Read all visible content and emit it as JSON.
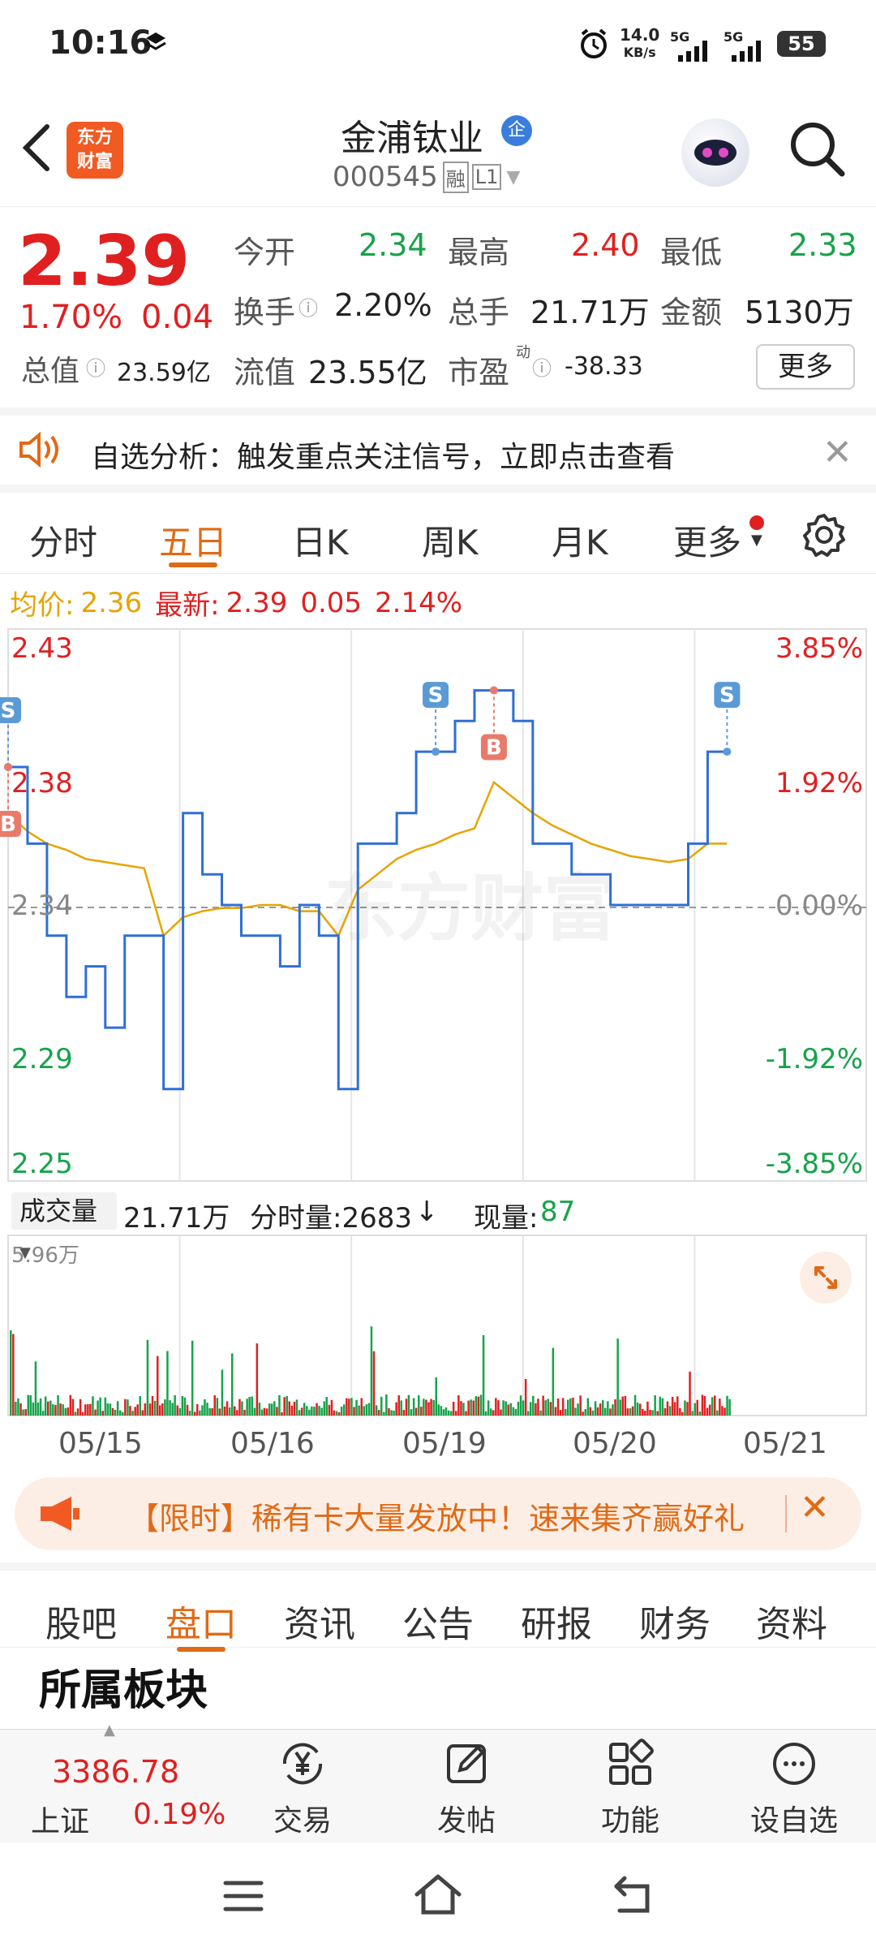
{
  "status": {
    "time": "10:16",
    "net_speed_value": "14.0",
    "net_speed_unit": "KB/s",
    "signal1": "5G",
    "signal2": "5G",
    "battery": "55"
  },
  "header": {
    "logo_line1": "东方",
    "logo_line2": "财富",
    "stock_name": "金浦钛业",
    "badge": "企",
    "stock_code": "000545",
    "tag1": "融",
    "tag2": "L1"
  },
  "quote": {
    "price": "2.39",
    "change_pct": "1.70%",
    "change": "0.04",
    "open_label": "今开",
    "open_value": "2.34",
    "high_label": "最高",
    "high_value": "2.40",
    "low_label": "最低",
    "low_value": "2.33",
    "turnover_label": "换手",
    "turnover_value": "2.20%",
    "volume_label": "总手",
    "volume_value": "21.71万",
    "amount_label": "金额",
    "amount_value": "5130万",
    "mktcap_label": "总值",
    "mktcap_value": "23.59亿",
    "float_label": "流值",
    "float_value": "23.55亿",
    "pe_label": "市盈",
    "pe_sup": "动",
    "pe_value": "-38.33",
    "more_label": "更多"
  },
  "banner": {
    "text": "自选分析：触发重点关注信号，立即点击查看"
  },
  "tabs": [
    "分时",
    "五日",
    "日K",
    "周K",
    "月K",
    "更多"
  ],
  "active_tab": "五日",
  "chart_header": {
    "avg_label": "均价:",
    "avg_value": "2.36",
    "latest_label": "最新:",
    "latest_value": "2.39",
    "latest_change": "0.05",
    "latest_pct": "2.14%"
  },
  "volume_header": {
    "label": "成交量",
    "total": "21.71万",
    "tick_label": "分时量:2683",
    "tick_arrow": "↓",
    "current_label": "现量:",
    "current_value": "87",
    "max_label": "5.96万"
  },
  "chart_data": {
    "type": "line",
    "x": [
      "05/15",
      "05/16",
      "05/19",
      "05/20",
      "05/21"
    ],
    "ylim": [
      2.25,
      2.43
    ],
    "y_ticks_left": [
      "2.43",
      "2.38",
      "2.34",
      "2.29",
      "2.25"
    ],
    "y_ticks_right": [
      "3.85%",
      "1.92%",
      "0.00%",
      "-1.92%",
      "-3.85%"
    ],
    "prev_close": 2.34,
    "series": [
      {
        "color": "#2f6fd6",
        "values": [
          2.385,
          2.36,
          2.33,
          2.31,
          2.32,
          2.3,
          2.33,
          2.33,
          2.28,
          2.37,
          2.35,
          2.34,
          2.33,
          2.33,
          2.32,
          2.34,
          2.33,
          2.28,
          2.36,
          2.36,
          2.37,
          2.39,
          2.39,
          2.4,
          2.41,
          2.41,
          2.4,
          2.36,
          2.36,
          2.35,
          2.35,
          2.34,
          2.34,
          2.34,
          2.34,
          2.36,
          2.39,
          2.39
        ]
      },
      {
        "color": "#e6a400",
        "values": [
          2.37,
          2.364,
          2.36,
          2.358,
          2.355,
          2.354,
          2.353,
          2.352,
          2.33,
          2.336,
          2.338,
          2.339,
          2.339,
          2.34,
          2.34,
          2.338,
          2.338,
          2.33,
          2.345,
          2.35,
          2.355,
          2.358,
          2.36,
          2.363,
          2.365,
          2.38,
          2.375,
          2.37,
          2.366,
          2.363,
          2.36,
          2.358,
          2.356,
          2.355,
          2.354,
          2.355,
          2.36,
          2.36
        ]
      }
    ],
    "markers": [
      {
        "label": "S",
        "x_index": 0
      },
      {
        "label": "B",
        "x_index": 0
      },
      {
        "label": "S",
        "x_index": 22
      },
      {
        "label": "B",
        "x_index": 25
      },
      {
        "label": "S",
        "x_index": 37
      }
    ],
    "volume_max": "5.96万"
  },
  "promo": {
    "text": "【限时】稀有卡大量发放中！速来集齐赢好礼"
  },
  "sub_tabs": [
    "股吧",
    "盘口",
    "资讯",
    "公告",
    "研报",
    "财务",
    "资料"
  ],
  "active_sub_tab": "盘口",
  "section_title": "所属板块",
  "bottom": {
    "index_value": "3386.78",
    "index_name": "上证",
    "index_pct": "0.19%",
    "trade": "交易",
    "post": "发帖",
    "functions": "功能",
    "watchlist": "设自选"
  },
  "colors": {
    "up": "#e02020",
    "down": "#16a34a",
    "accent": "#e06a16",
    "price_line": "#2f6fd6",
    "avg_line": "#e6a400"
  }
}
